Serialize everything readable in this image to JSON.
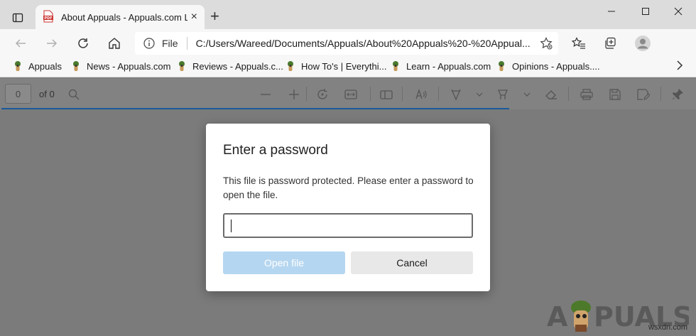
{
  "window": {
    "tab_title": "About Appuals - Appuals.com Lo",
    "tab_close": "×",
    "new_tab": "+"
  },
  "navbar": {
    "file_label": "File",
    "url": "C:/Users/Wareed/Documents/Appuals/About%20Appuals%20-%20Appual..."
  },
  "bookmarks": [
    {
      "label": "Appuals"
    },
    {
      "label": "News - Appuals.com"
    },
    {
      "label": "Reviews - Appuals.c..."
    },
    {
      "label": "How To's | Everythi..."
    },
    {
      "label": "Learn - Appuals.com"
    },
    {
      "label": "Opinions - Appuals...."
    }
  ],
  "pdf_toolbar": {
    "page_number": "0",
    "page_count": "of 0"
  },
  "dialog": {
    "title": "Enter a password",
    "message": "This file is password protected. Please enter a password to open the file.",
    "password_value": "",
    "open_label": "Open file",
    "cancel_label": "Cancel"
  },
  "watermark": {
    "logo_text": "A  PUALS",
    "site": "wsxdn.com"
  },
  "colors": {
    "accent": "#1a5a9c",
    "open_button_disabled": "#b5d6f0",
    "overlay": "#7b7b7b"
  }
}
